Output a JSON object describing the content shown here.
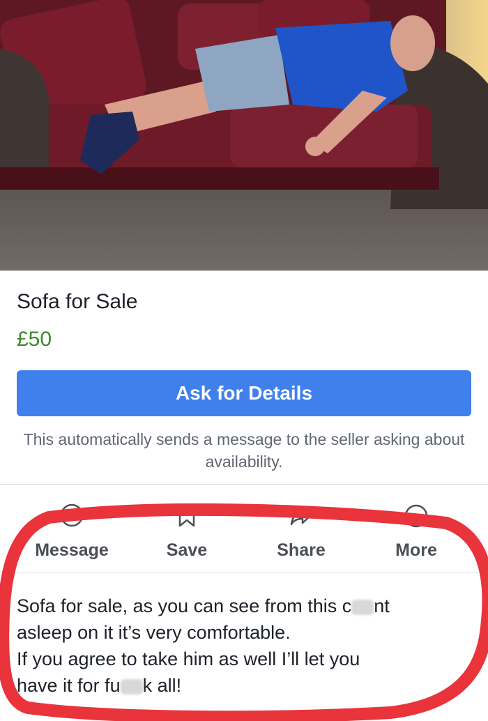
{
  "listing": {
    "title": "Sofa for Sale",
    "price": "£50",
    "ask_button_label": "Ask for Details",
    "helper_text": "This automatically sends a message to the seller asking about availability."
  },
  "actions": [
    {
      "label": "Message",
      "icon": "messenger-icon"
    },
    {
      "label": "Save",
      "icon": "bookmark-icon"
    },
    {
      "label": "Share",
      "icon": "share-icon"
    },
    {
      "label": "More",
      "icon": "more-icon"
    }
  ],
  "description": {
    "line1_a": "Sofa for sale, as you can see from this c",
    "line1_b": "nt",
    "line2": "asleep on it it’s very comfortable.",
    "line3": "If you agree to take him as well I’ll let you",
    "line4_a": "have it for fu",
    "line4_b": "k all!"
  },
  "colors": {
    "price": "#3c8a2e",
    "button": "#4080ec",
    "annotation": "#e8343a"
  }
}
